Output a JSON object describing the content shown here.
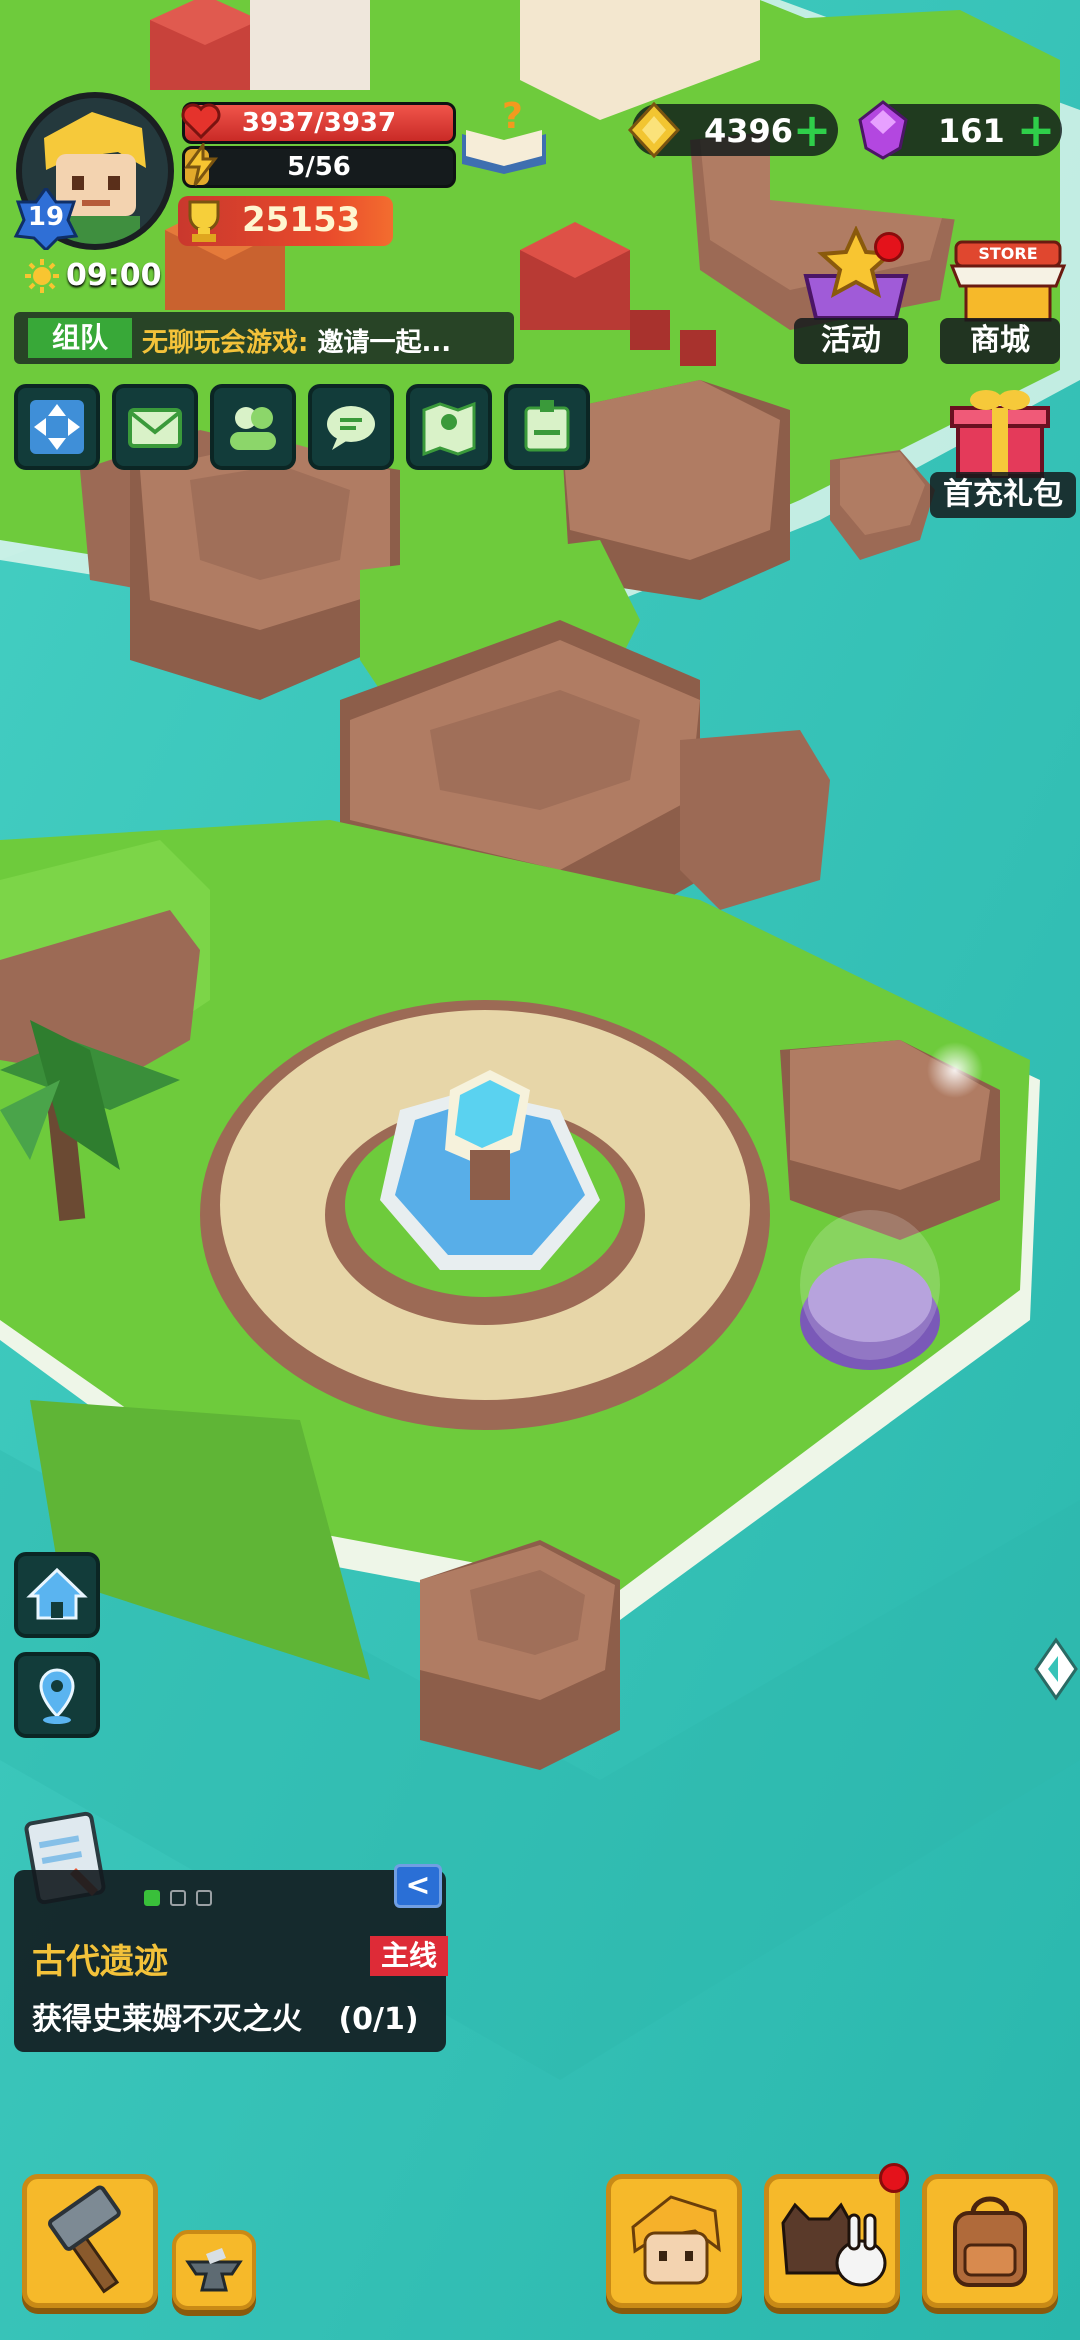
{
  "player": {
    "level": "19",
    "hp": "3937/3937",
    "energy": "5/56",
    "power": "25153",
    "time": "09:00"
  },
  "team": {
    "tag": "组队",
    "message_prefix": "无聊玩会游戏: ",
    "message_rest": "邀请一起..."
  },
  "currency": {
    "gold": "4396",
    "gems": "161"
  },
  "menu": {
    "activity_label": "活动",
    "store_label": "商城",
    "store_sign": "STORE",
    "first_pack_label": "首充礼包"
  },
  "quest": {
    "title": "古代遗迹",
    "tag": "主线",
    "description": "获得史莱姆不灭之火",
    "progress": "(0/1)",
    "back_glyph": "<"
  },
  "icons": {
    "quick_row": [
      "expand-icon",
      "mail-icon",
      "friends-icon",
      "chat-icon",
      "map-icon",
      "badge-icon"
    ],
    "side": [
      "home-icon",
      "location-pin-icon"
    ],
    "bottom": [
      "build-hammer-icon",
      "anvil-icon",
      "hero-icon",
      "pets-icon",
      "backpack-icon"
    ]
  },
  "colors": {
    "sea": "#37c3b8",
    "grass": "#6ecb3c",
    "rock": "#b07c63",
    "gold_text": "#f3c23a",
    "quest_tag": "#de2b37",
    "hp_bar": "#e2352d",
    "button_orange": "#f6b92a"
  }
}
